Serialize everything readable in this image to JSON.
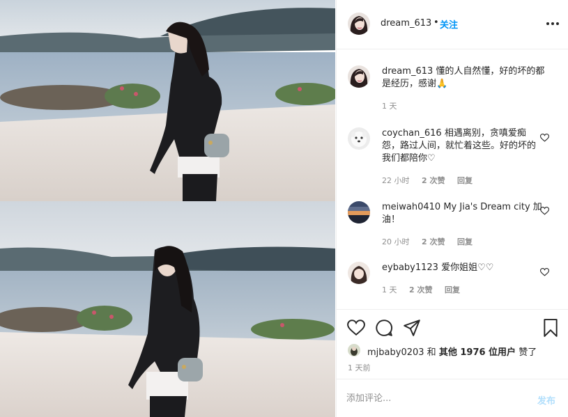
{
  "post": {
    "username": "dream_613",
    "dot": "•",
    "follow_label": "关注"
  },
  "comments": [
    {
      "username": "dream_613",
      "text": "懂的人自然懂，好的坏的都是经历，感谢🙏",
      "time": "1 天",
      "likes": "",
      "reply": "",
      "avatar_icon": "woman-portrait-avatar"
    },
    {
      "username": "coychan_616",
      "text": "相遇离别，贪嗔爱痴怨，路过人间，就忙着这些。好的坏的我们都陪你♡",
      "time": "22 小时",
      "likes": "2 次赞",
      "reply": "回复",
      "avatar_icon": "dog-avatar"
    },
    {
      "username": "meiwah0410",
      "text": "My Jia's Dream city 加油！",
      "time": "20 小时",
      "likes": "2 次赞",
      "reply": "回复",
      "avatar_icon": "sunset-avatar"
    },
    {
      "username": "eybaby1123",
      "text": "爱你姐姐♡♡",
      "time": "1 天",
      "likes": "2 次赞",
      "reply": "回复",
      "avatar_icon": "girl-avatar"
    }
  ],
  "likes": {
    "user": "mjbaby0203",
    "and": "和",
    "others": "其他 1976 位用户",
    "verb": "赞了"
  },
  "post_time": "1 天前",
  "add_comment": {
    "placeholder": "添加评论...",
    "post_label": "发布"
  },
  "colors": {
    "accent": "#0095f6",
    "post_disabled": "#b2dffc",
    "meta": "#8e8e8e"
  }
}
